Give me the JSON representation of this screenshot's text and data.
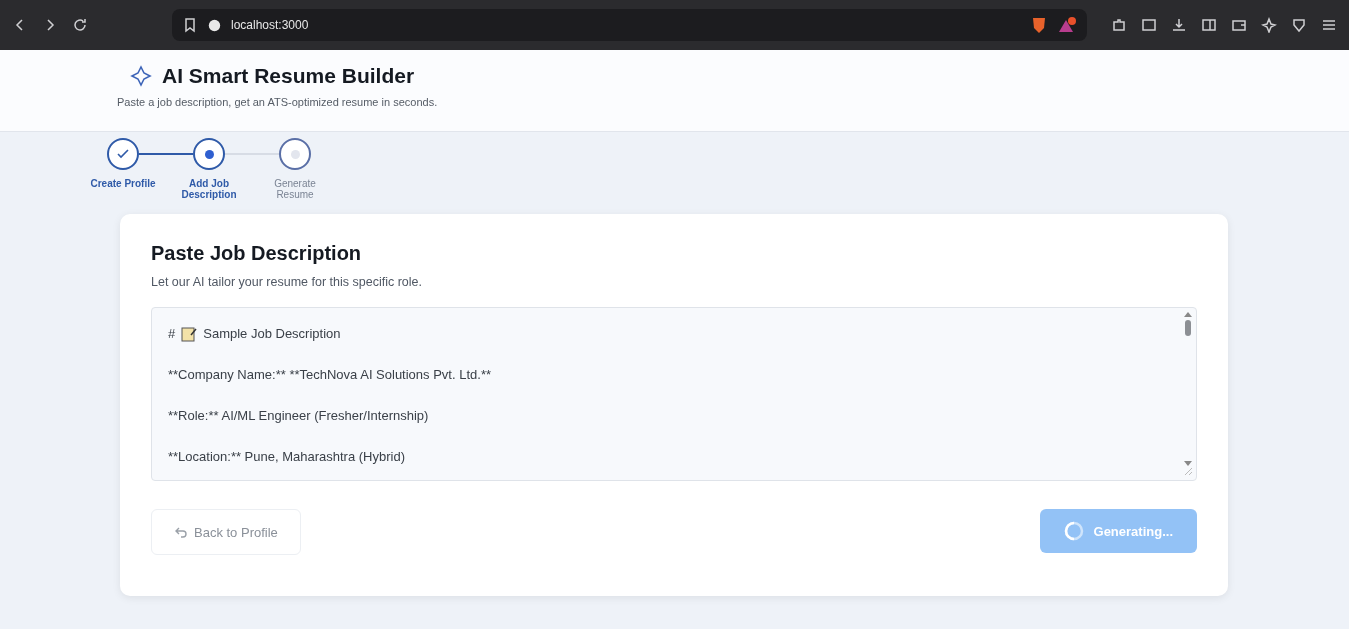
{
  "browser": {
    "url": "localhost:3000"
  },
  "header": {
    "title": "AI Smart Resume Builder",
    "subtitle": "Paste a job description, get an ATS-optimized resume in seconds."
  },
  "steps": [
    {
      "label": "Create Profile",
      "kind": "done"
    },
    {
      "label": "Add Job Description",
      "kind": "current"
    },
    {
      "label": "Generate Resume",
      "kind": "pending"
    }
  ],
  "card": {
    "title": "Paste Job Description",
    "subtitle": "Let our AI tailor your resume for this specific role.",
    "lines": [
      {
        "kind": "heading",
        "prefix": "#",
        "text": "Sample Job Description"
      },
      {
        "kind": "text",
        "text": "**Company Name:** **TechNova AI Solutions Pvt. Ltd.**"
      },
      {
        "kind": "text",
        "text": "**Role:** AI/ML Engineer (Fresher/Internship)"
      },
      {
        "kind": "text",
        "text": "**Location:** Pune, Maharashtra (Hybrid)"
      }
    ],
    "back_button": "Back to Profile",
    "generate_button": {
      "label": "Generating...",
      "disabled": true
    }
  }
}
